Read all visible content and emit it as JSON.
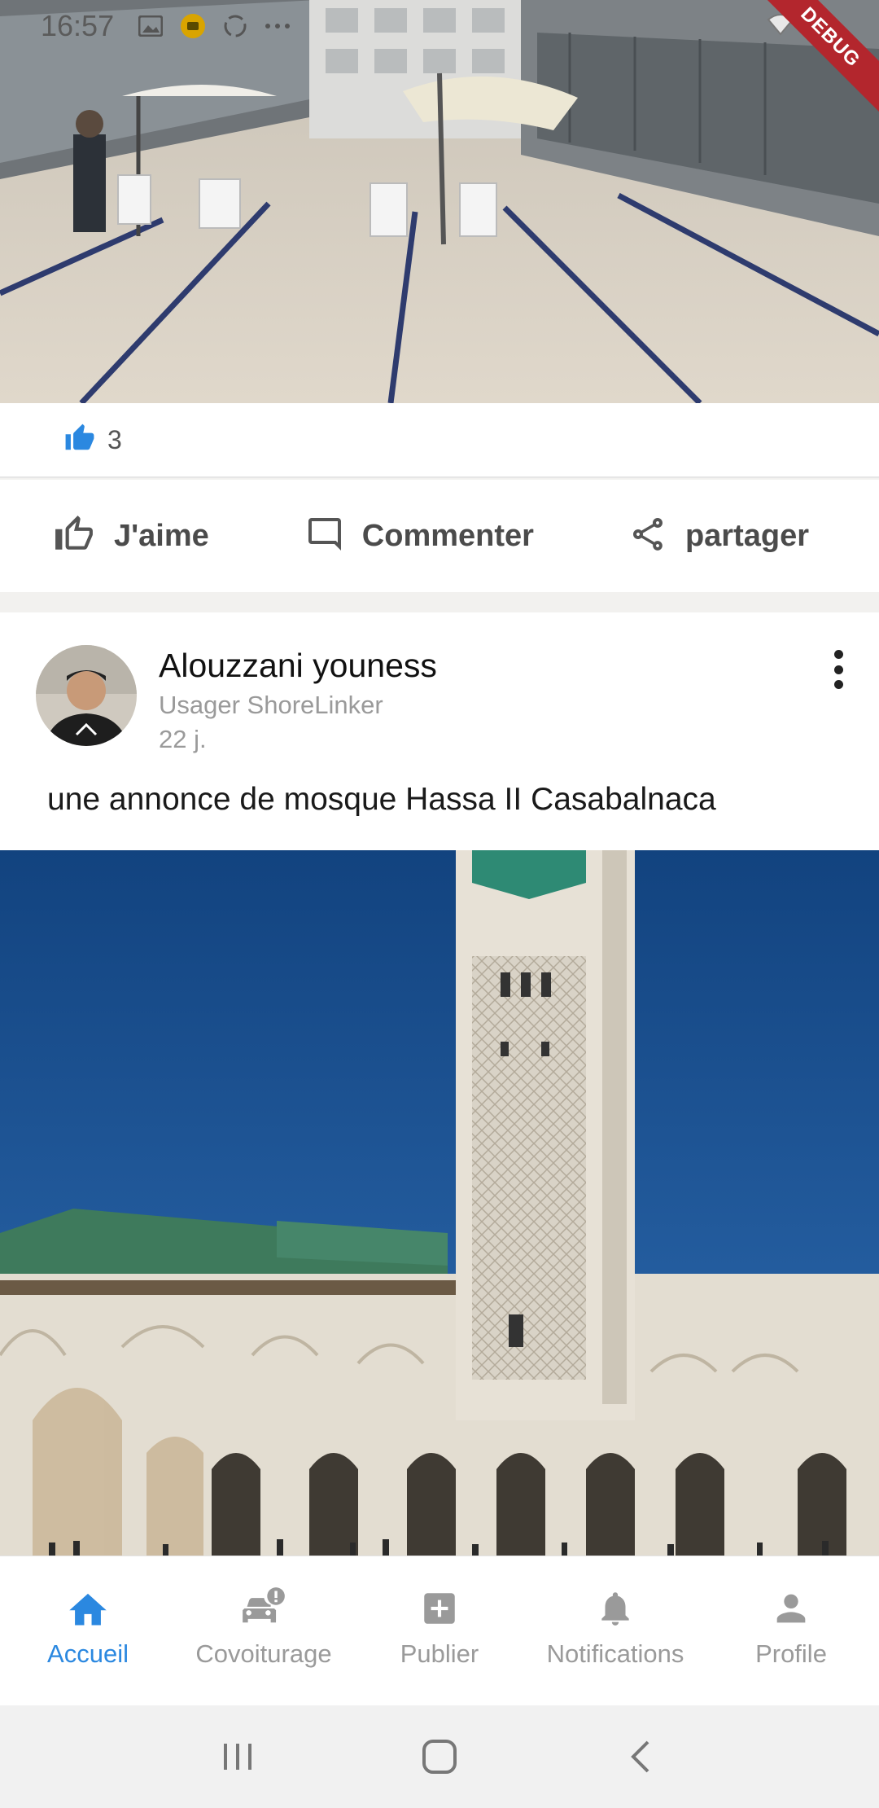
{
  "status_bar": {
    "time": "16:57",
    "debug_label": "DEBUG"
  },
  "previous_post": {
    "like_count": "3",
    "actions": {
      "like": "J'aime",
      "comment": "Commenter",
      "share": "partager"
    }
  },
  "post": {
    "author_name": "Alouzzani youness",
    "author_role": "Usager ShoreLinker",
    "age": "22 j.",
    "text": "une annonce de mosque Hassa II Casabalnaca"
  },
  "bottom_nav": {
    "items": [
      {
        "label": "Accueil",
        "icon": "home-icon",
        "active": true
      },
      {
        "label": "Covoiturage",
        "icon": "car-alert-icon",
        "active": false
      },
      {
        "label": "Publier",
        "icon": "add-box-icon",
        "active": false
      },
      {
        "label": "Notifications",
        "icon": "bell-icon",
        "active": false
      },
      {
        "label": "Profile",
        "icon": "person-icon",
        "active": false
      }
    ]
  },
  "colors": {
    "accent": "#2b88e0",
    "inactive": "#9a9a9a",
    "debug": "#b3262d"
  }
}
